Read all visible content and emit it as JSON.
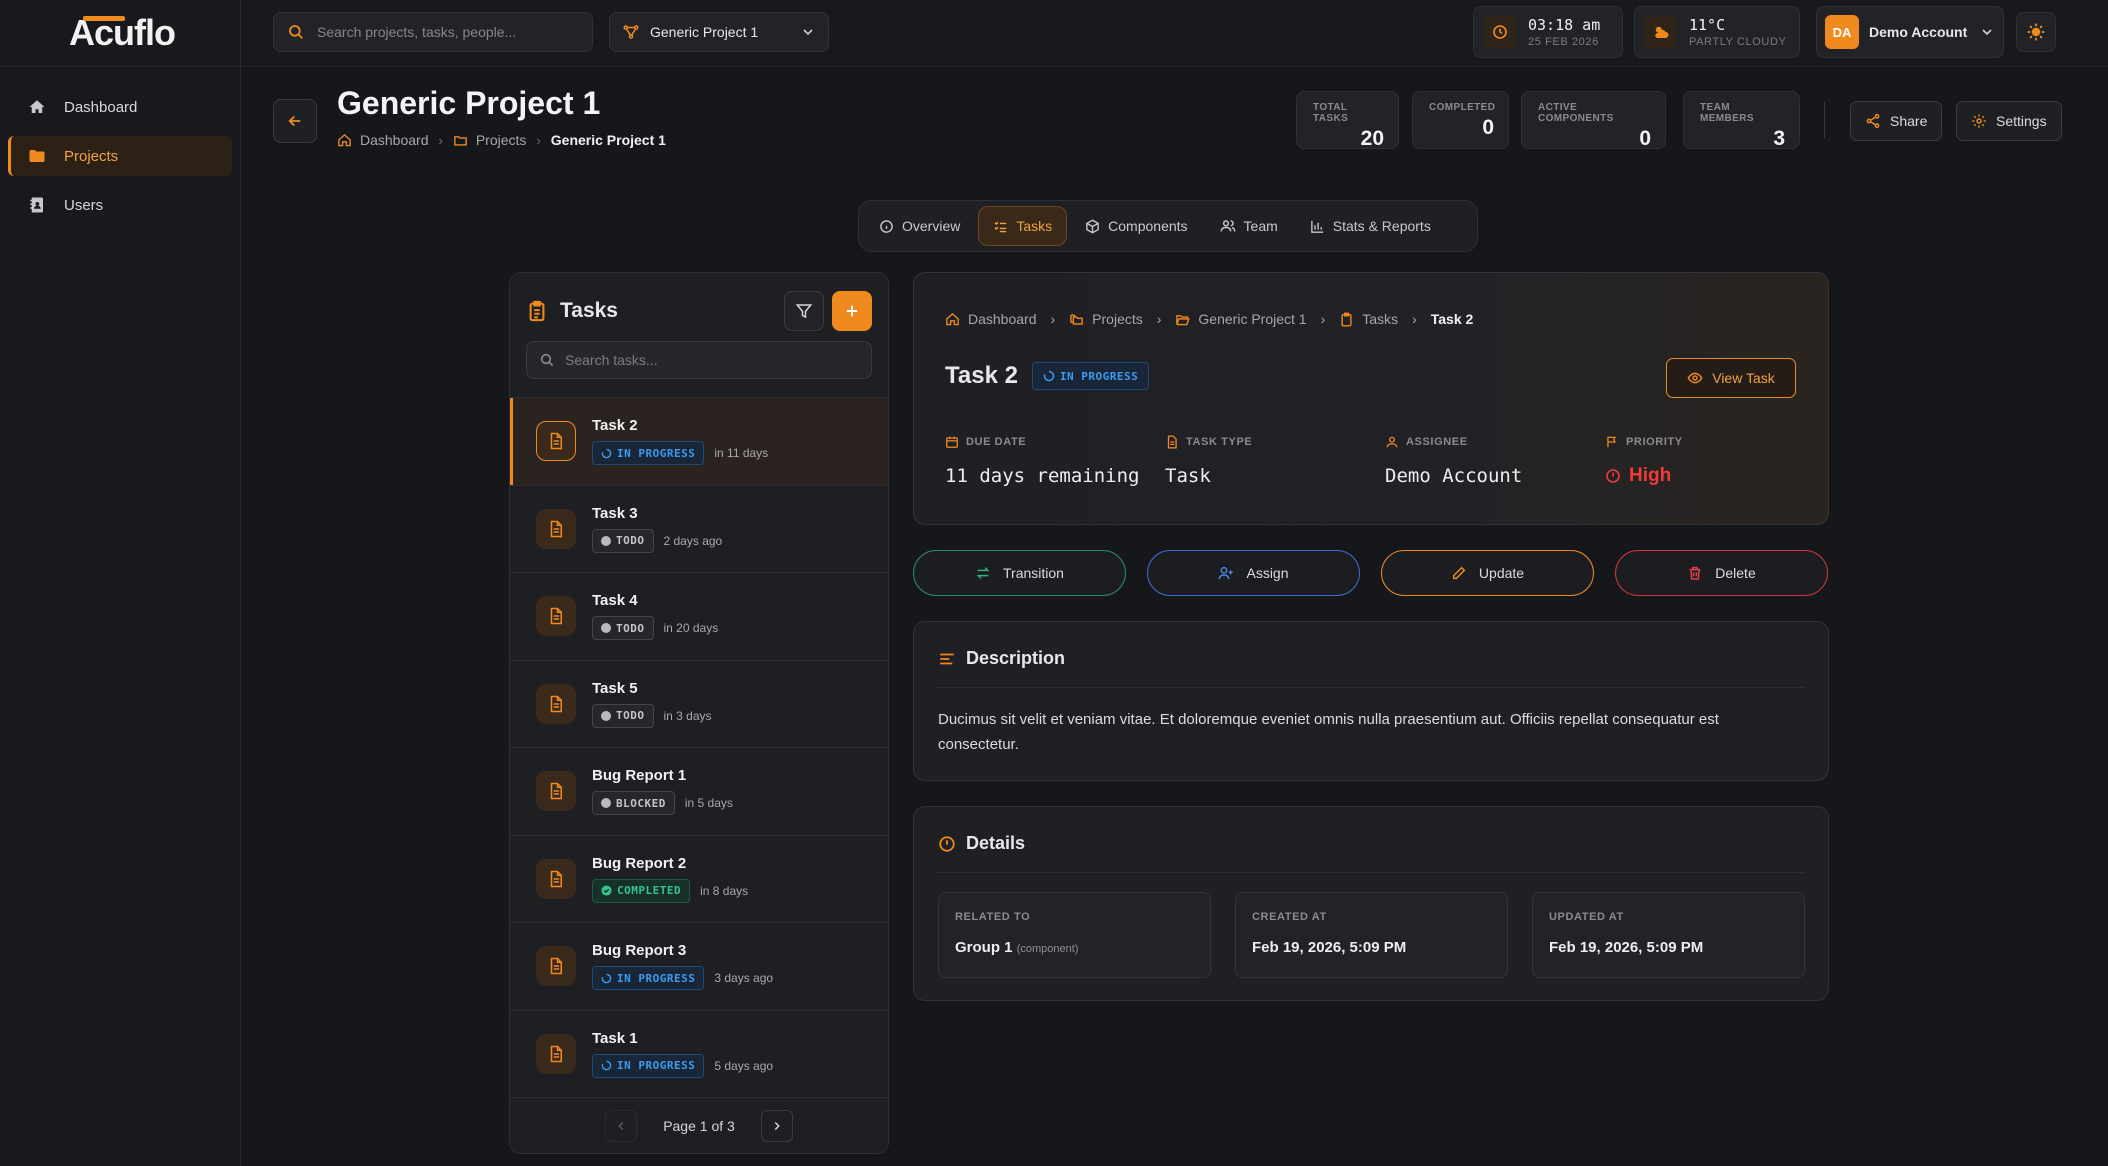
{
  "app": {
    "logo": "Acuflo"
  },
  "sidebar": {
    "items": [
      {
        "label": "Dashboard",
        "icon": "home-icon"
      },
      {
        "label": "Projects",
        "icon": "folder-icon",
        "active": true
      },
      {
        "label": "Users",
        "icon": "address-book-icon"
      }
    ]
  },
  "topbar": {
    "search_placeholder": "Search projects, tasks, people...",
    "project_select": "Generic Project 1",
    "time": "03:18 am",
    "date": "25 FEB 2026",
    "temp": "11°C",
    "weather": "PARTLY CLOUDY",
    "account_initials": "DA",
    "account_name": "Demo Account"
  },
  "header": {
    "title": "Generic Project 1",
    "breadcrumb": [
      "Dashboard",
      "Projects",
      "Generic Project 1"
    ],
    "stats": [
      {
        "label": "TOTAL TASKS",
        "value": "20"
      },
      {
        "label": "COMPLETED",
        "value": "0"
      },
      {
        "label": "ACTIVE COMPONENTS",
        "value": "0"
      },
      {
        "label": "TEAM MEMBERS",
        "value": "3"
      }
    ],
    "share_label": "Share",
    "settings_label": "Settings"
  },
  "tabs": [
    {
      "label": "Overview"
    },
    {
      "label": "Tasks",
      "active": true
    },
    {
      "label": "Components"
    },
    {
      "label": "Team"
    },
    {
      "label": "Stats & Reports"
    }
  ],
  "tasks_panel": {
    "title": "Tasks",
    "search_placeholder": "Search tasks...",
    "items": [
      {
        "name": "Task 2",
        "status": "IN PROGRESS",
        "due": "in 11 days",
        "selected": true
      },
      {
        "name": "Task 3",
        "status": "TODO",
        "due": "2 days ago"
      },
      {
        "name": "Task 4",
        "status": "TODO",
        "due": "in 20 days"
      },
      {
        "name": "Task 5",
        "status": "TODO",
        "due": "in 3 days"
      },
      {
        "name": "Bug Report 1",
        "status": "BLOCKED",
        "due": "in 5 days"
      },
      {
        "name": "Bug Report 2",
        "status": "COMPLETED",
        "due": "in 8 days"
      },
      {
        "name": "Bug Report 3",
        "status": "IN PROGRESS",
        "due": "3 days ago"
      },
      {
        "name": "Task 1",
        "status": "IN PROGRESS",
        "due": "5 days ago"
      }
    ],
    "pagination": "Page 1 of 3"
  },
  "task_detail": {
    "breadcrumb": [
      "Dashboard",
      "Projects",
      "Generic Project 1",
      "Tasks",
      "Task 2"
    ],
    "title": "Task 2",
    "status": "IN PROGRESS",
    "view_label": "View Task",
    "fields": [
      {
        "label": "DUE DATE",
        "value": "11 days remaining"
      },
      {
        "label": "TASK TYPE",
        "value": "Task"
      },
      {
        "label": "ASSIGNEE",
        "value": "Demo Account"
      },
      {
        "label": "PRIORITY",
        "value": "High"
      }
    ],
    "actions": [
      "Transition",
      "Assign",
      "Update",
      "Delete"
    ],
    "description_title": "Description",
    "description": "Ducimus sit velit et veniam vitae. Et doloremque eveniet omnis nulla praesentium aut. Officiis repellat consequatur est consectetur.",
    "details_title": "Details",
    "details": [
      {
        "label": "RELATED TO",
        "value": "Group 1",
        "sub": "(component)"
      },
      {
        "label": "CREATED AT",
        "value": "Feb 19, 2026, 5:09 PM"
      },
      {
        "label": "UPDATED AT",
        "value": "Feb 19, 2026, 5:09 PM"
      }
    ]
  },
  "colors": {
    "accent": "#f08a1e",
    "bg": "#16171b",
    "progress": "#3c9bf0",
    "completed": "#33c48a",
    "danger": "#ef3b3b"
  }
}
